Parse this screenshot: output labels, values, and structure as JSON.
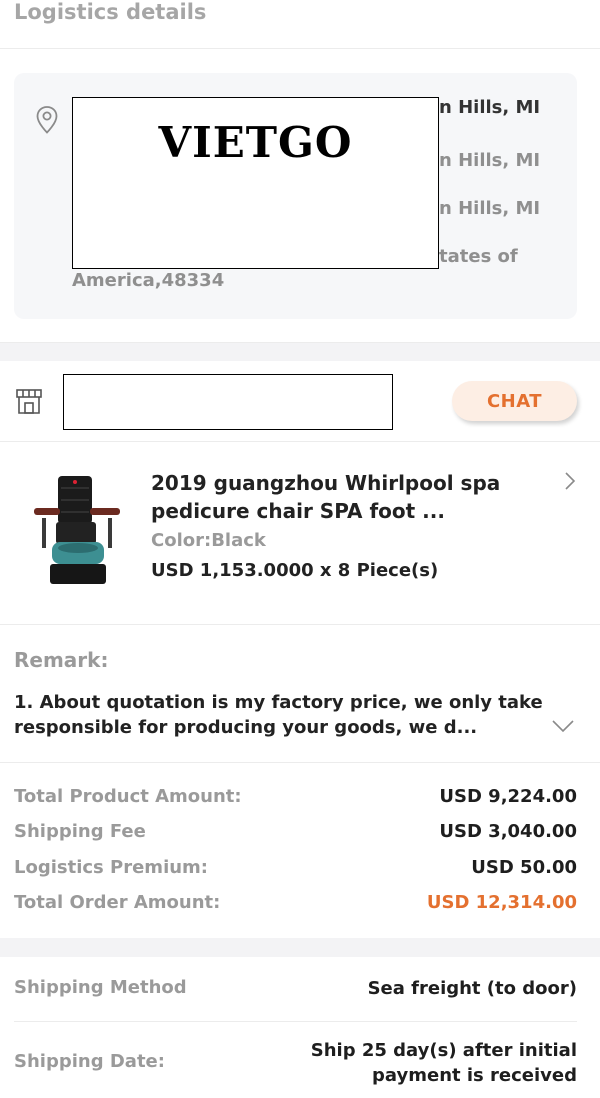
{
  "header": {
    "title": "Logistics details"
  },
  "address": {
    "lines": [
      "n Hills, MI",
      "n Hills, MI",
      "n Hills, MI",
      "tates of",
      "America,48334"
    ],
    "redaction_text": "VIETGO"
  },
  "seller": {
    "chat_label": "CHAT"
  },
  "product": {
    "title": "2019 guangzhou Whirlpool spa pedicure chair SPA foot ...",
    "color": "Color:Black",
    "price": "USD 1,153.0000 x 8 Piece(s)"
  },
  "remark": {
    "label": "Remark:",
    "text": "1. About quotation is my factory price, we only take responsible for producing your goods, we d..."
  },
  "summary": {
    "rows": [
      {
        "label": "Total Product Amount:",
        "value": "USD 9,224.00"
      },
      {
        "label": "Shipping Fee",
        "value": "USD 3,040.00"
      },
      {
        "label": "Logistics Premium:",
        "value": "USD 50.00"
      },
      {
        "label": "Total Order Amount:",
        "value": "USD 12,314.00"
      }
    ]
  },
  "shipping": {
    "method_label": "Shipping Method",
    "method_value": "Sea freight (to door)",
    "date_label": "Shipping Date:",
    "date_value_line1": "Ship 25 day(s) after initial",
    "date_value_line2": "payment is received"
  },
  "colors": {
    "accent": "#e4702f",
    "muted": "#9a9a9a",
    "card_bg": "#f6f7f9"
  }
}
